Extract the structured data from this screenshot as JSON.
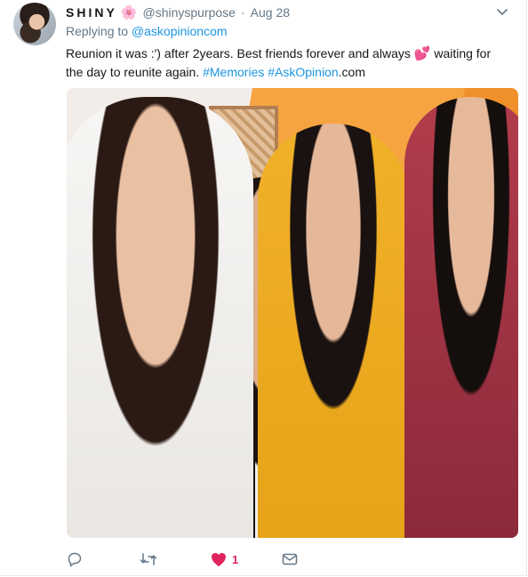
{
  "user": {
    "display_name": "SHINY",
    "name_emoji": "🌸",
    "handle": "@shinyspurpose",
    "separator": "·",
    "date": "Aug 28"
  },
  "reply": {
    "prefix": "Replying to",
    "to": "@askopinioncom"
  },
  "tweet": {
    "text_part1": "Reunion it was :') after 2years. Best friends forever and always ",
    "emoji": "💕",
    "text_part2": " waiting for the day to reunite again. ",
    "hashtag1": "#Memories",
    "hashtag2": "#AskOpinion",
    "suffix": ".com"
  },
  "actions": {
    "like_count": "1"
  },
  "colors": {
    "link": "#1b95e0",
    "muted": "#657786",
    "like": "#e0245e"
  }
}
